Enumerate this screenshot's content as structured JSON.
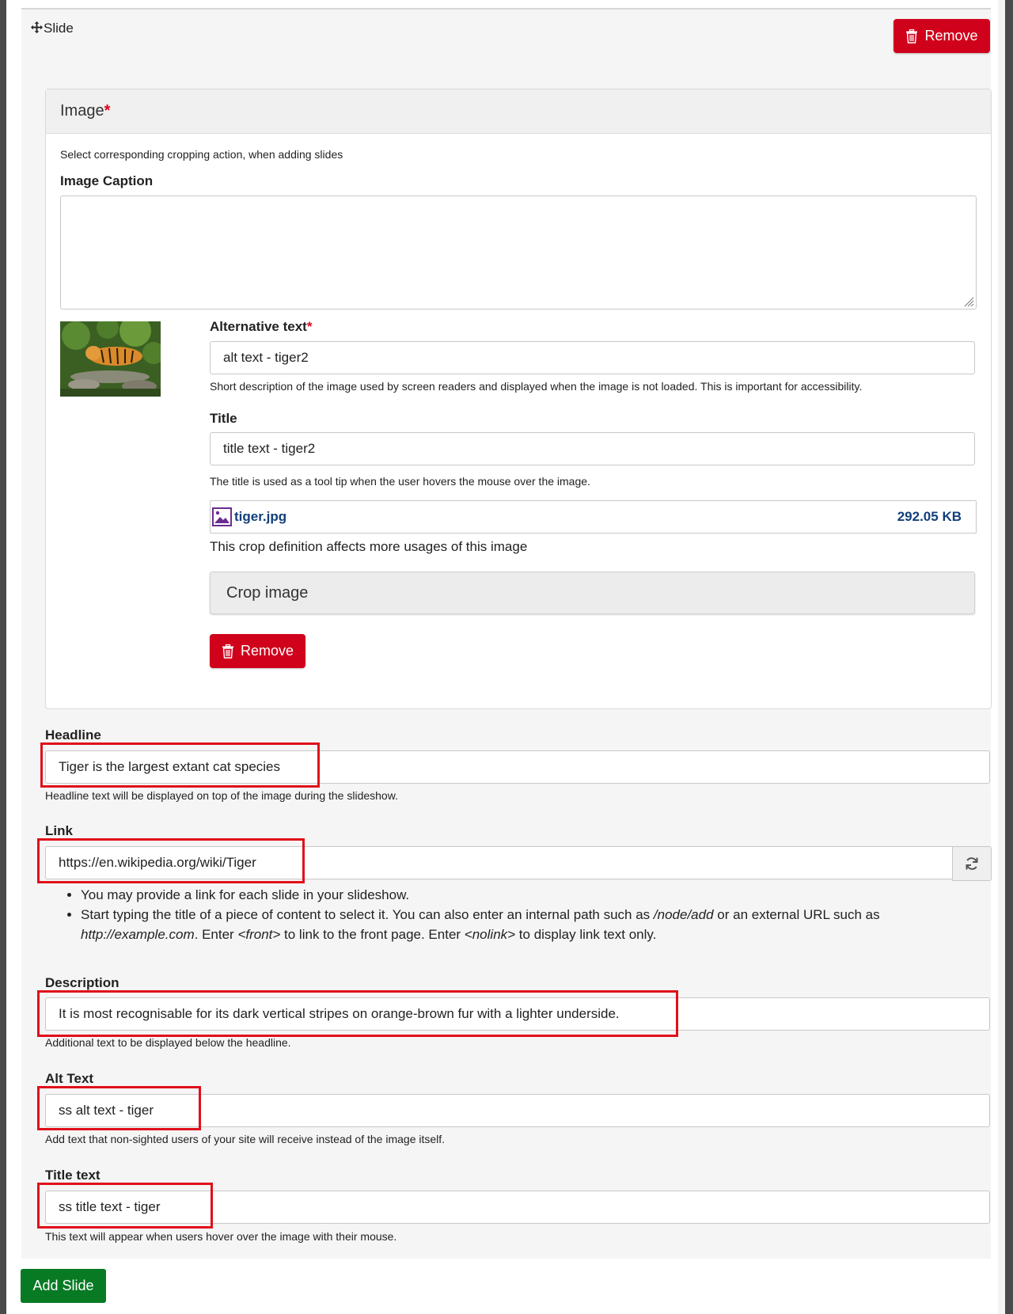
{
  "slide": {
    "handle_label": "Slide",
    "remove_label": "Remove"
  },
  "image_panel": {
    "title": "Image",
    "required_mark": "*",
    "hint": "Select corresponding cropping action, when adding slides",
    "caption_label": "Image Caption",
    "caption_value": "",
    "alt": {
      "label": "Alternative text",
      "required_mark": "*",
      "value": "alt text - tiger2",
      "description": "Short description of the image used by screen readers and displayed when the image is not loaded. This is important for accessibility."
    },
    "title_field": {
      "label": "Title",
      "value": "title text - tiger2",
      "description": "The title is used as a tool tip when the user hovers the mouse over the image."
    },
    "file": {
      "name": "tiger.jpg",
      "size": "292.05 KB",
      "icon": "image-file-icon"
    },
    "crop_notice": "This crop definition affects more usages of this image",
    "crop_label": "Crop image",
    "remove_label": "Remove"
  },
  "headline": {
    "label": "Headline",
    "value": "Tiger is the largest extant cat species",
    "description": "Headline text will be displayed on top of the image during the slideshow."
  },
  "link": {
    "label": "Link",
    "value": "https://en.wikipedia.org/wiki/Tiger",
    "refresh_icon": "refresh-icon",
    "bullet_1": "You may provide a link for each slide in your slideshow.",
    "bullet_2_a": "Start typing the title of a piece of content to select it. You can also enter an internal path such as ",
    "bullet_2_path": "/node/add",
    "bullet_2_b": " or an external URL such as ",
    "bullet_2_url": "http://example.com",
    "bullet_2_c": ". Enter ",
    "bullet_2_front": "<front>",
    "bullet_2_d": " to link to the front page. Enter ",
    "bullet_2_nolink": "<nolink>",
    "bullet_2_e": " to display link text only."
  },
  "description": {
    "label": "Description",
    "value": "It is most recognisable for its dark vertical stripes on orange-brown fur with a lighter underside.",
    "description": "Additional text to be displayed below the headline."
  },
  "alt_text": {
    "label": "Alt Text",
    "value": "ss alt text - tiger",
    "description": "Add text that non-sighted users of your site will receive instead of the image itself."
  },
  "title_text": {
    "label": "Title text",
    "value": "ss title text - tiger",
    "description": "This text will appear when users hover over the image with their mouse."
  },
  "add_slide_label": "Add Slide",
  "colors": {
    "danger": "#d0021b",
    "success": "#087a24",
    "highlight": "#e0101a",
    "file_link": "#123f7a"
  }
}
